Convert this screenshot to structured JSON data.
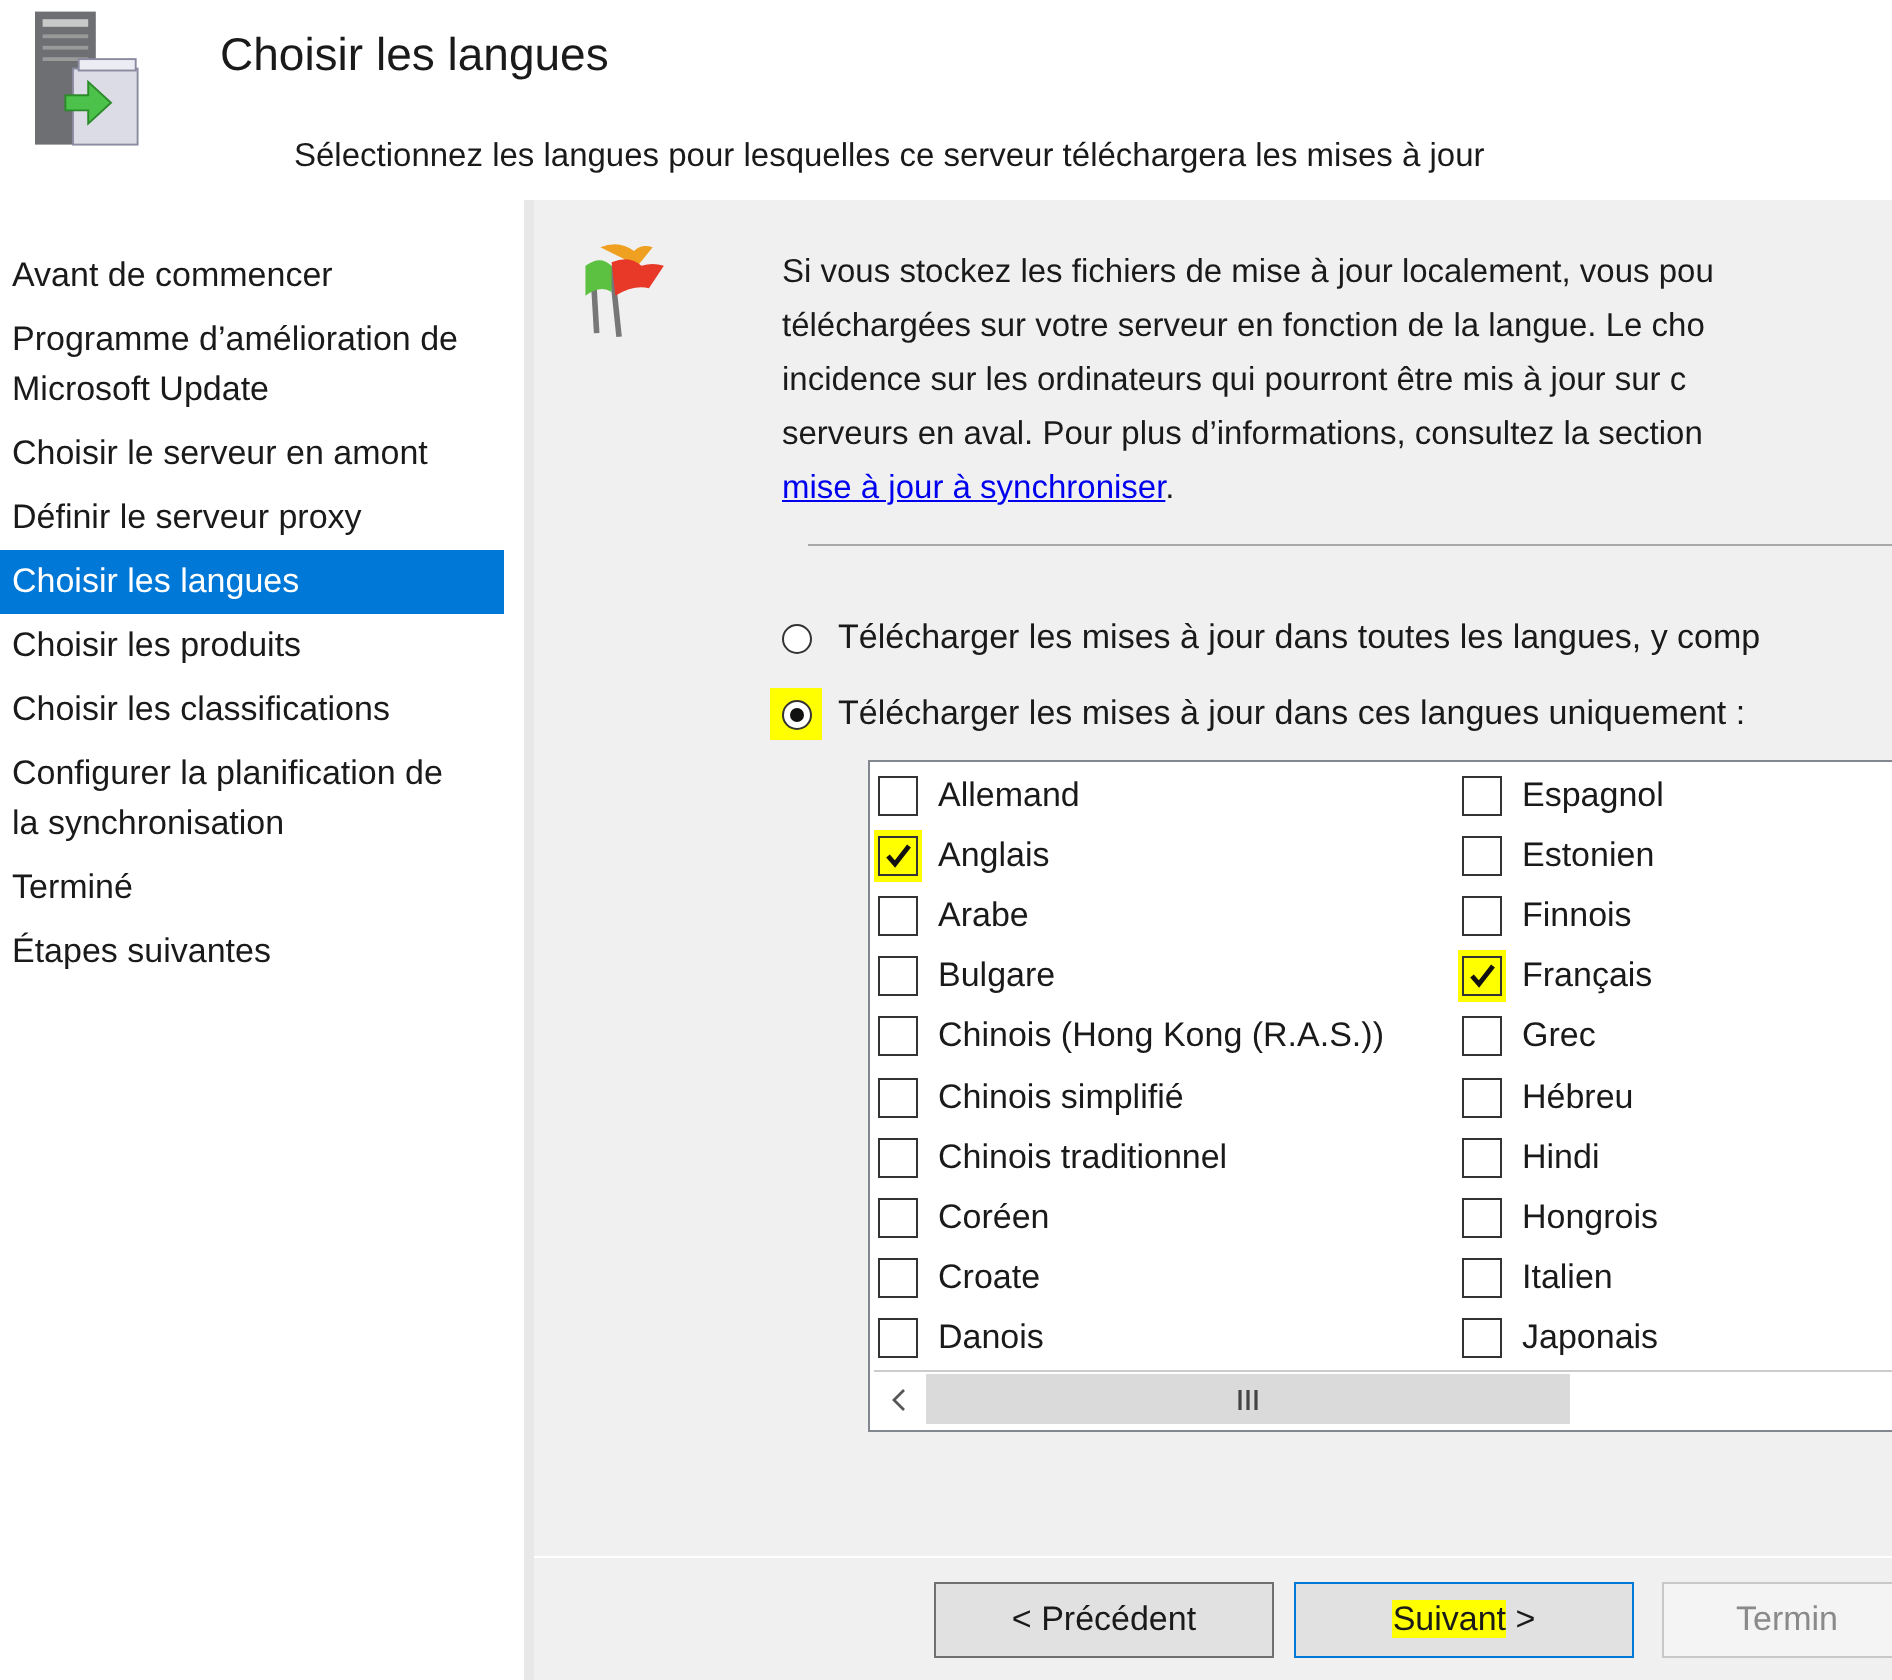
{
  "header": {
    "title": "Choisir les langues",
    "subtitle": "Sélectionnez les langues pour lesquelles ce serveur téléchargera les mises à jour"
  },
  "sidebar": {
    "items": [
      {
        "label": "Avant de commencer",
        "selected": false
      },
      {
        "label": "Programme d’amélioration de Microsoft Update",
        "selected": false
      },
      {
        "label": "Choisir le serveur en amont",
        "selected": false
      },
      {
        "label": "Définir le serveur proxy",
        "selected": false
      },
      {
        "label": "Choisir les langues",
        "selected": true
      },
      {
        "label": "Choisir les produits",
        "selected": false
      },
      {
        "label": "Choisir les classifications",
        "selected": false
      },
      {
        "label": "Configurer la planification de la synchronisation",
        "selected": false
      },
      {
        "label": "Terminé",
        "selected": false
      },
      {
        "label": "Étapes suivantes",
        "selected": false
      }
    ]
  },
  "intro": {
    "lines": [
      "Si vous stockez les fichiers de mise à jour localement, vous pou",
      "téléchargées sur votre serveur en fonction de la langue. Le cho",
      "incidence sur les ordinateurs qui pourront être mis à jour sur c",
      "serveurs en aval. Pour plus d’informations, consultez la section"
    ],
    "link": "mise à jour à synchroniser",
    "after_link": "."
  },
  "options": [
    {
      "label": "Télécharger les mises à jour dans toutes les langues, y comp",
      "selected": false,
      "highlighted": false
    },
    {
      "label": "Télécharger les mises à jour dans ces langues uniquement :",
      "selected": true,
      "highlighted": true
    }
  ],
  "languages": {
    "columns": [
      [
        {
          "label": "Allemand",
          "checked": false,
          "highlighted": false
        },
        {
          "label": "Anglais",
          "checked": true,
          "highlighted": true
        },
        {
          "label": "Arabe",
          "checked": false,
          "highlighted": false
        },
        {
          "label": "Bulgare",
          "checked": false,
          "highlighted": false
        },
        {
          "label": "Chinois (Hong Kong (R.A.S.))",
          "checked": false,
          "highlighted": false
        },
        {
          "label": "Chinois simplifié",
          "checked": false,
          "highlighted": false
        },
        {
          "label": "Chinois traditionnel",
          "checked": false,
          "highlighted": false
        },
        {
          "label": "Coréen",
          "checked": false,
          "highlighted": false
        },
        {
          "label": "Croate",
          "checked": false,
          "highlighted": false
        },
        {
          "label": "Danois",
          "checked": false,
          "highlighted": false
        }
      ],
      [
        {
          "label": "Espagnol",
          "checked": false,
          "highlighted": false
        },
        {
          "label": "Estonien",
          "checked": false,
          "highlighted": false
        },
        {
          "label": "Finnois",
          "checked": false,
          "highlighted": false
        },
        {
          "label": "Français",
          "checked": true,
          "highlighted": true
        },
        {
          "label": "Grec",
          "checked": false,
          "highlighted": false
        },
        {
          "label": "Hébreu",
          "checked": false,
          "highlighted": false
        },
        {
          "label": "Hindi",
          "checked": false,
          "highlighted": false
        },
        {
          "label": "Hongrois",
          "checked": false,
          "highlighted": false
        },
        {
          "label": "Italien",
          "checked": false,
          "highlighted": false
        },
        {
          "label": "Japonais",
          "checked": false,
          "highlighted": false
        }
      ]
    ]
  },
  "buttons": [
    {
      "parts": [
        {
          "text": "< Précédent",
          "highlighted": false
        }
      ],
      "focused": false,
      "disabled": false
    },
    {
      "parts": [
        {
          "text": "Suivant",
          "highlighted": true
        },
        {
          "text": " >",
          "highlighted": false
        }
      ],
      "focused": true,
      "disabled": false
    },
    {
      "parts": [
        {
          "text": "Termin",
          "highlighted": false
        }
      ],
      "focused": false,
      "disabled": true
    }
  ]
}
